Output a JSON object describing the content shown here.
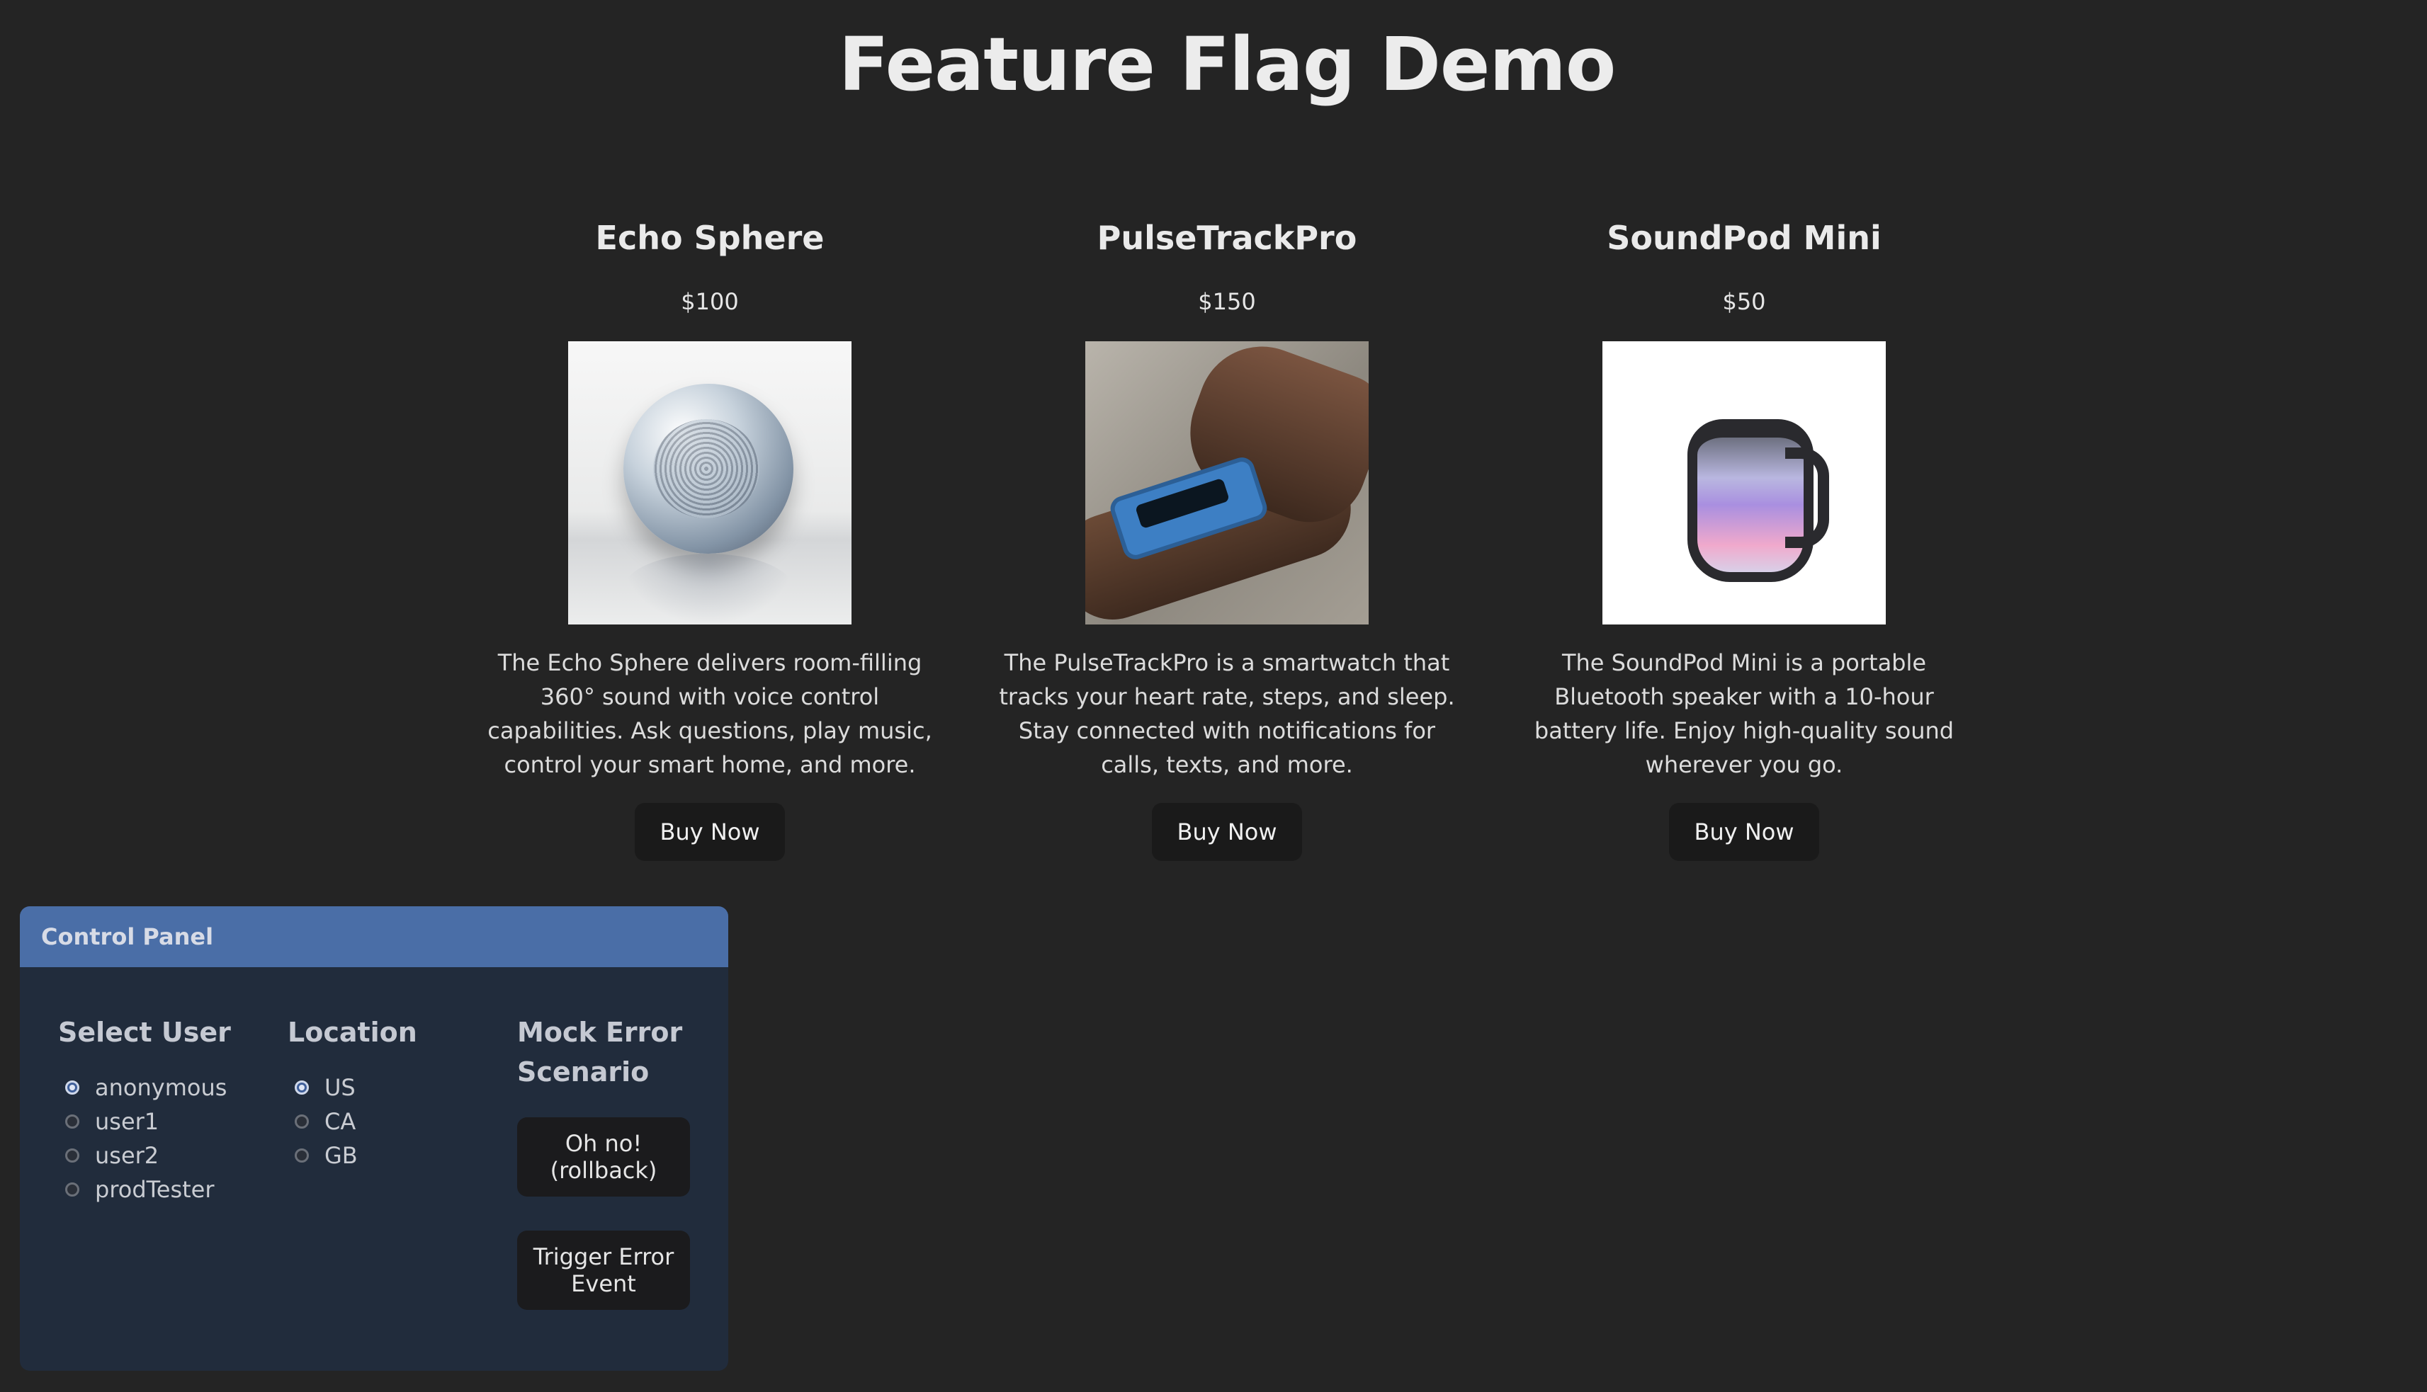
{
  "page": {
    "title": "Feature Flag Demo"
  },
  "products": [
    {
      "name": "Echo Sphere",
      "price": "$100",
      "image": "speaker-sphere-image",
      "description": "The Echo Sphere delivers room-filling 360° sound with voice control capabilities. Ask questions, play music, control your smart home, and more.",
      "button": "Buy Now"
    },
    {
      "name": "PulseTrackPro",
      "price": "$150",
      "image": "smartwatch-wrist-image",
      "description": "The PulseTrackPro is a smartwatch that tracks your heart rate, steps, and sleep. Stay connected with notifications for calls, texts, and more.",
      "button": "Buy Now"
    },
    {
      "name": "SoundPod Mini",
      "price": "$50",
      "image": "portable-speaker-image",
      "description": "The SoundPod Mini is a portable Bluetooth speaker with a 10-hour battery life. Enjoy high-quality sound wherever you go.",
      "button": "Buy Now"
    }
  ],
  "control_panel": {
    "title": "Control Panel",
    "select_user": {
      "heading": "Select User",
      "options": [
        "anonymous",
        "user1",
        "user2",
        "prodTester"
      ],
      "selected": "anonymous"
    },
    "location": {
      "heading": "Location",
      "options": [
        "US",
        "CA",
        "GB"
      ],
      "selected": "US"
    },
    "mock_error": {
      "heading": "Mock Error Scenario",
      "buttons": [
        "Oh no! (rollback)",
        "Trigger Error Event"
      ]
    }
  },
  "colors": {
    "background": "#242424",
    "panel_header": "#4a6ea7",
    "panel_body": "#212c3c",
    "button": "#1a1a1a"
  }
}
